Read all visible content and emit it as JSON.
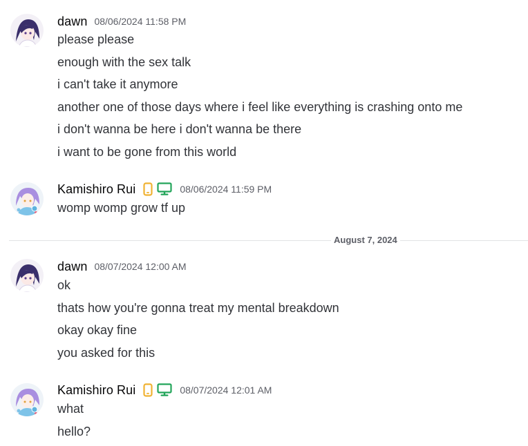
{
  "groups": [
    {
      "username": "dawn",
      "timestamp": "08/06/2024 11:58 PM",
      "avatar_icon": "dawn-avatar",
      "lines": [
        "please please",
        "enough with the sex talk",
        "i can't take it anymore",
        "another one of those days where i feel like everything is crashing onto me",
        "i don't wanna be here i don't wanna be there",
        "i want to be gone from this world"
      ]
    },
    {
      "username": "Kamishiro Rui",
      "timestamp": "08/06/2024 11:59 PM",
      "avatar_icon": "rui-avatar",
      "badges": [
        "mobile-phone-icon",
        "desktop-monitor-icon"
      ],
      "lines": [
        "womp womp grow tf up"
      ]
    },
    {
      "username": "dawn",
      "timestamp": "08/07/2024 12:00 AM",
      "avatar_icon": "dawn-avatar",
      "lines": [
        "ok",
        "thats how you're gonna treat my mental breakdown",
        "okay okay fine",
        "you asked for this"
      ]
    },
    {
      "username": "Kamishiro Rui",
      "timestamp": "08/07/2024 12:01 AM",
      "avatar_icon": "rui-avatar",
      "badges": [
        "mobile-phone-icon",
        "desktop-monitor-icon"
      ],
      "lines": [
        "what",
        "hello?"
      ]
    }
  ],
  "date_divider": "August 7, 2024",
  "colors": {
    "mobile_badge": "#f0b232",
    "desktop_badge": "#23a55a",
    "divider_line": "#e1e2e4"
  }
}
